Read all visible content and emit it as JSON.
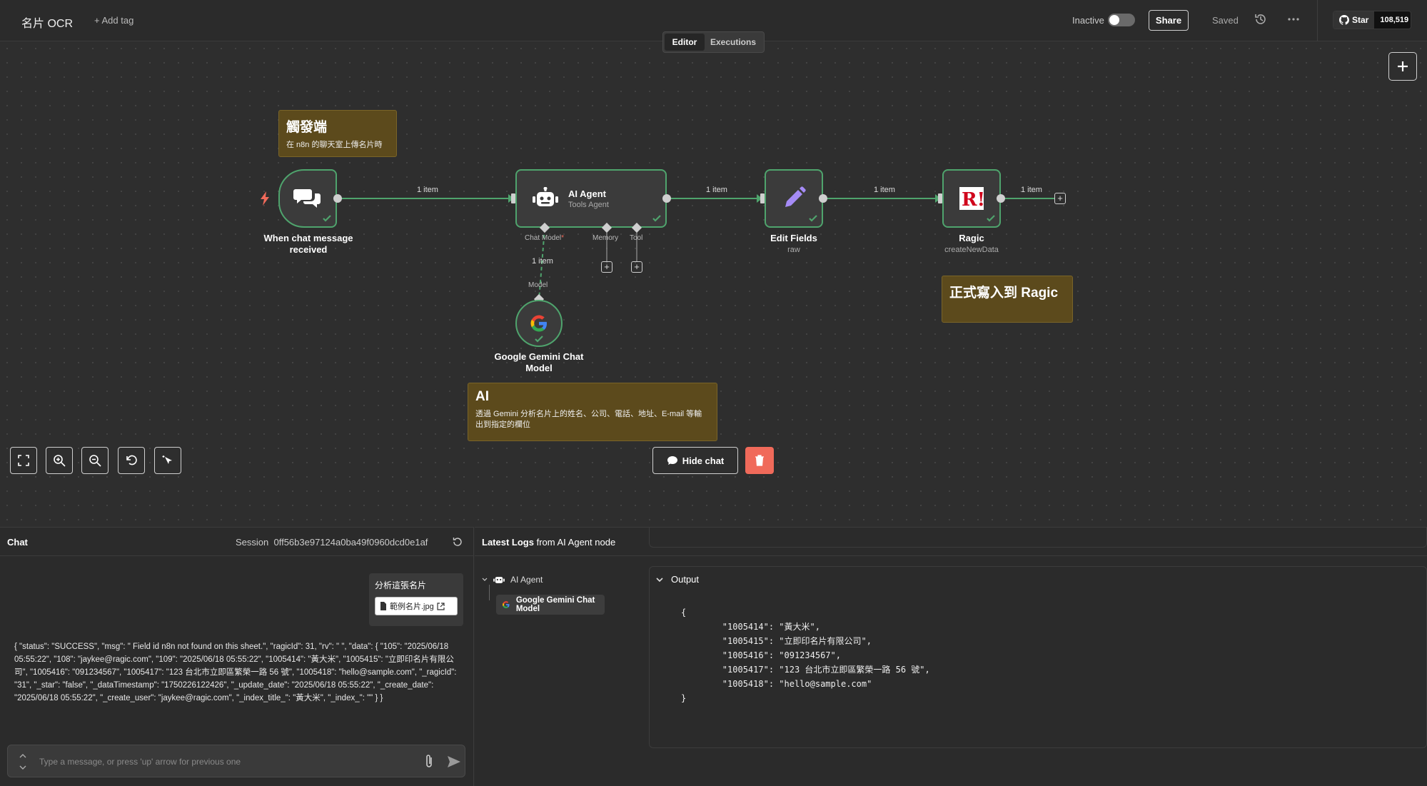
{
  "header": {
    "title": "名片 OCR",
    "add_tag": "+ Add tag",
    "inactive_label": "Inactive",
    "share": "Share",
    "saved": "Saved",
    "github_star": "Star",
    "github_count": "108,519"
  },
  "tabs": {
    "editor": "Editor",
    "executions": "Executions"
  },
  "notes": {
    "trigger": {
      "title": "觸發端",
      "body": "在 n8n 的聊天室上傳名片時"
    },
    "write": {
      "title": "正式寫入到 Ragic"
    },
    "ai": {
      "title": "AI",
      "body": "透過 Gemini 分析名片上的姓名、公司、電話、地址、E-mail 等輸出到指定的欄位"
    }
  },
  "nodes": {
    "trigger": {
      "label": "When chat message received"
    },
    "agent": {
      "title": "AI Agent",
      "sub": "Tools Agent",
      "chat_model": "Chat Model",
      "memory": "Memory",
      "tool": "Tool"
    },
    "edit": {
      "label": "Edit Fields",
      "sub": "raw"
    },
    "ragic": {
      "label": "Ragic",
      "sub": "createNewData"
    },
    "gemini": {
      "label": "Google Gemini Chat Model",
      "port": "Model"
    }
  },
  "connections": {
    "item_label": "1 item"
  },
  "toolbar": {
    "hide_chat": "Hide chat"
  },
  "chat": {
    "title": "Chat",
    "session_label": "Session",
    "session_id": "0ff56b3e97124a0ba49f0960dcd0e1af",
    "user_message": "分析這張名片",
    "file_name": "範例名片.jpg",
    "bot_message": "{ \"status\": \"SUCCESS\", \"msg\": \"  Field id n8n not found on this sheet.\", \"ragicId\": 31, \"rv\": \"   \", \"data\": { \"105\": \"2025/06/18 05:55:22\", \"108\": \"jaykee@ragic.com\", \"109\": \"2025/06/18 05:55:22\", \"1005414\": \"黃大米\", \"1005415\": \"立即印名片有限公司\", \"1005416\": \"091234567\", \"1005417\": \"123 台北市立即區繁榮一路 56 號\", \"1005418\": \"hello@sample.com\", \"_ragicId\": \"31\", \"_star\": \"false\", \"_dataTimestamp\": \"1750226122426\", \"_update_date\": \"2025/06/18 05:55:22\", \"_create_date\": \"2025/06/18 05:55:22\", \"_create_user\": \"jaykee@ragic.com\", \"_index_title_\": \"黃大米\", \"_index_\": \"\" } }",
    "input_placeholder": "Type a message, or press 'up' arrow for previous one"
  },
  "logs": {
    "title_bold": "Latest Logs",
    "title_rest": "from AI Agent node",
    "tree_agent": "AI Agent",
    "tree_gemini": "Google Gemini Chat Model",
    "output_label": "Output",
    "output_json": "{\n        \"1005414\": \"黃大米\",\n        \"1005415\": \"立即印名片有限公司\",\n        \"1005416\": \"091234567\",\n        \"1005417\": \"123 台北市立即區繁榮一路 56 號\",\n        \"1005418\": \"hello@sample.com\"\n}"
  },
  "colors": {
    "node_border": "#4fa46d",
    "note_bg": "#5c4a1c",
    "trash": "#f06a5a"
  }
}
